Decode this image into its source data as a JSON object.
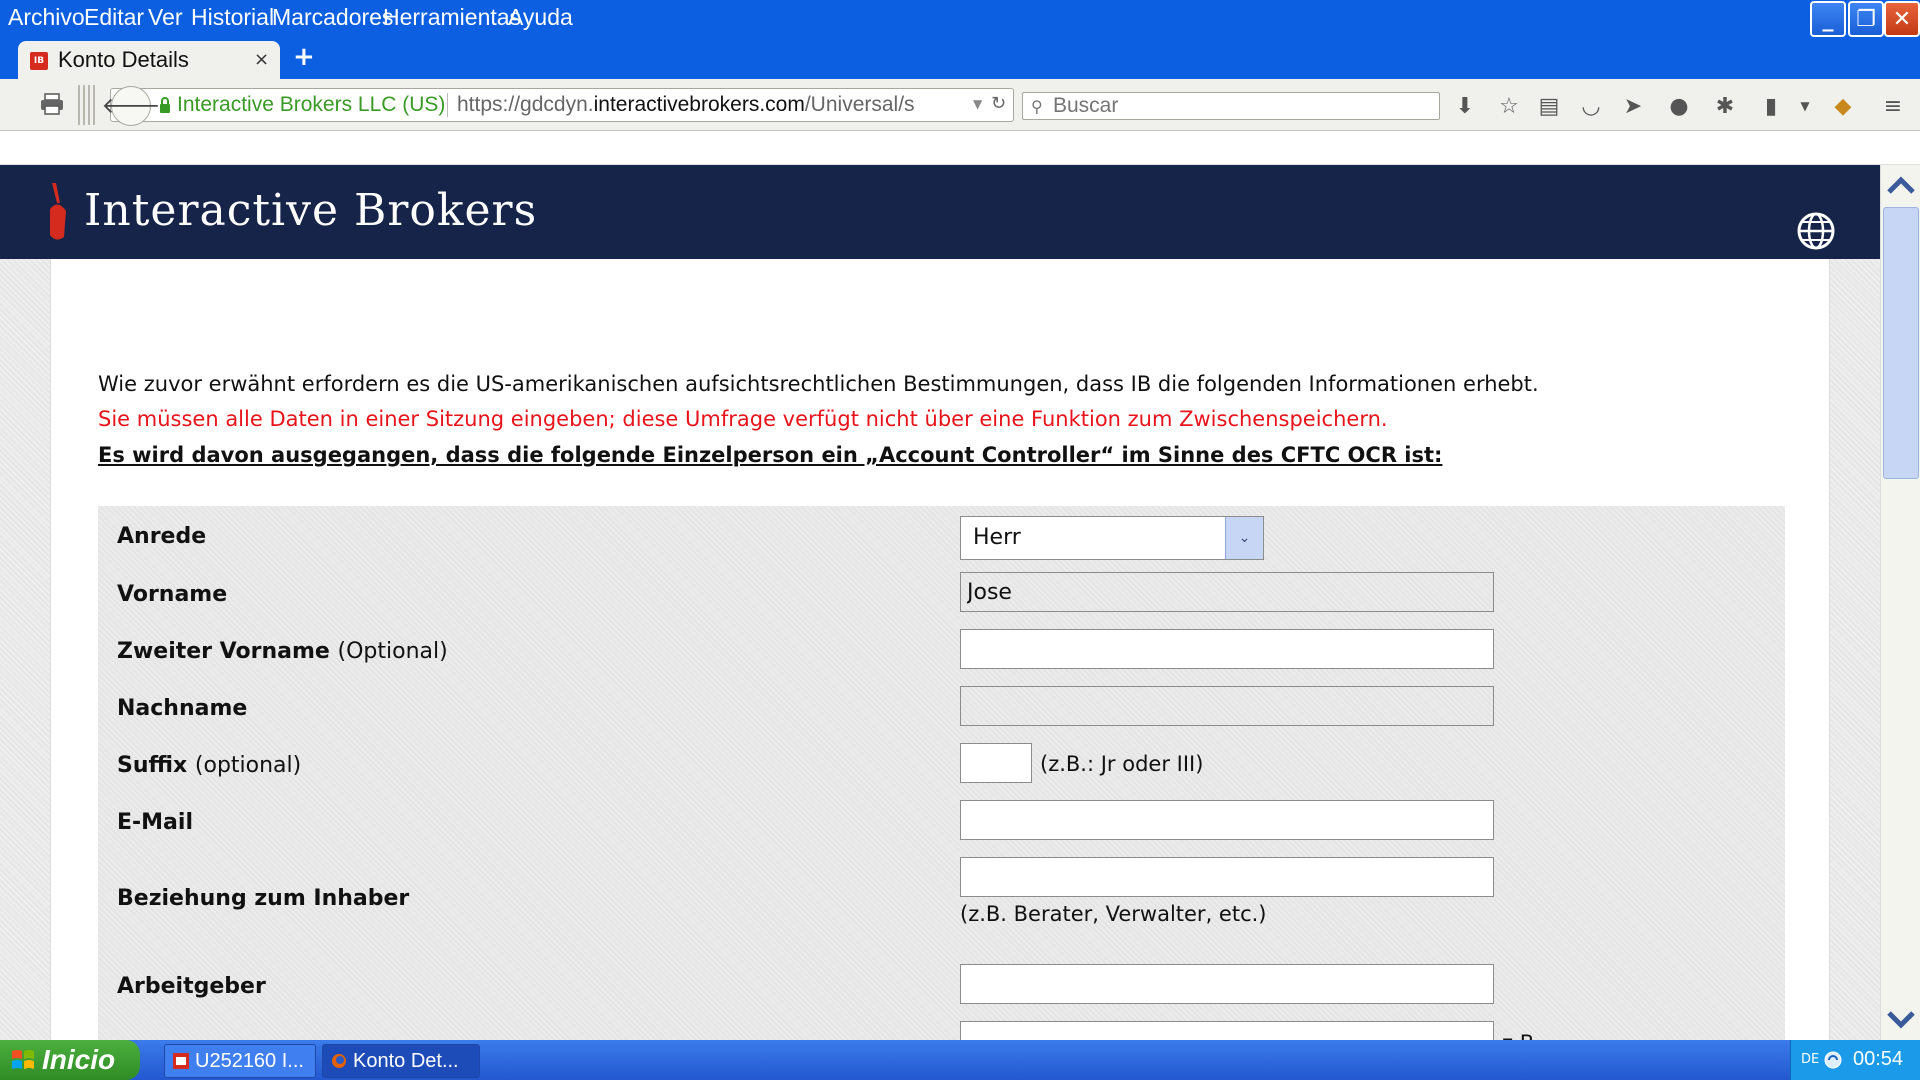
{
  "menu": [
    "Archivo",
    "Editar",
    "Ver",
    "Historial",
    "Marcadores",
    "Herramientas",
    "Ayuda"
  ],
  "tab": {
    "title": "Konto Details",
    "favicon": "IB",
    "close": "×",
    "new": "+"
  },
  "navbar": {
    "identity": "Interactive Brokers LLC (US)",
    "url_prefix": "https://gdcdyn.",
    "url_domain": "interactivebrokers.com",
    "url_suffix": "/Universal/s",
    "search_placeholder": "Buscar"
  },
  "site": {
    "brand": "Interactive Brokers"
  },
  "content": {
    "intro": "Wie zuvor erwähnt erfordern es die US-amerikanischen aufsichtsrechtlichen Bestimmungen, dass IB die folgenden Informationen erhebt.",
    "warning": "Sie müssen alle Daten in einer Sitzung eingeben; diese Umfrage verfügt nicht über eine Funktion zum Zwischenspeichern.",
    "assumption": "Es wird davon ausgegangen, dass die folgende Einzelperson ein „Account Controller“ im Sinne des CFTC OCR ist:"
  },
  "form": {
    "anrede": {
      "label": "Anrede",
      "value": "Herr"
    },
    "vorname": {
      "label": "Vorname",
      "value": "Jose"
    },
    "zweiter_vorname": {
      "label": "Zweiter Vorname",
      "optional": "(Optional)",
      "value": ""
    },
    "nachname": {
      "label": "Nachname",
      "value": ""
    },
    "suffix": {
      "label": "Suffix",
      "optional": "(optional)",
      "value": "",
      "hint": "(z.B.: Jr oder III)"
    },
    "email": {
      "label": "E-Mail",
      "value": ""
    },
    "beziehung": {
      "label": "Beziehung zum Inhaber",
      "value": "",
      "hint": "(z.B. Berater, Verwalter, etc.)"
    },
    "arbeitgeber": {
      "label": "Arbeitgeber",
      "value": ""
    },
    "next_hint": "z.B."
  },
  "taskbar": {
    "start": "Inicio",
    "tasks": [
      "U252160 I...",
      "Konto Det..."
    ],
    "lang": "DE",
    "clock": "00:54"
  },
  "colors": {
    "accent": "#16244a",
    "warning": "#e8141c",
    "titlebar": "#0b5fe0"
  }
}
